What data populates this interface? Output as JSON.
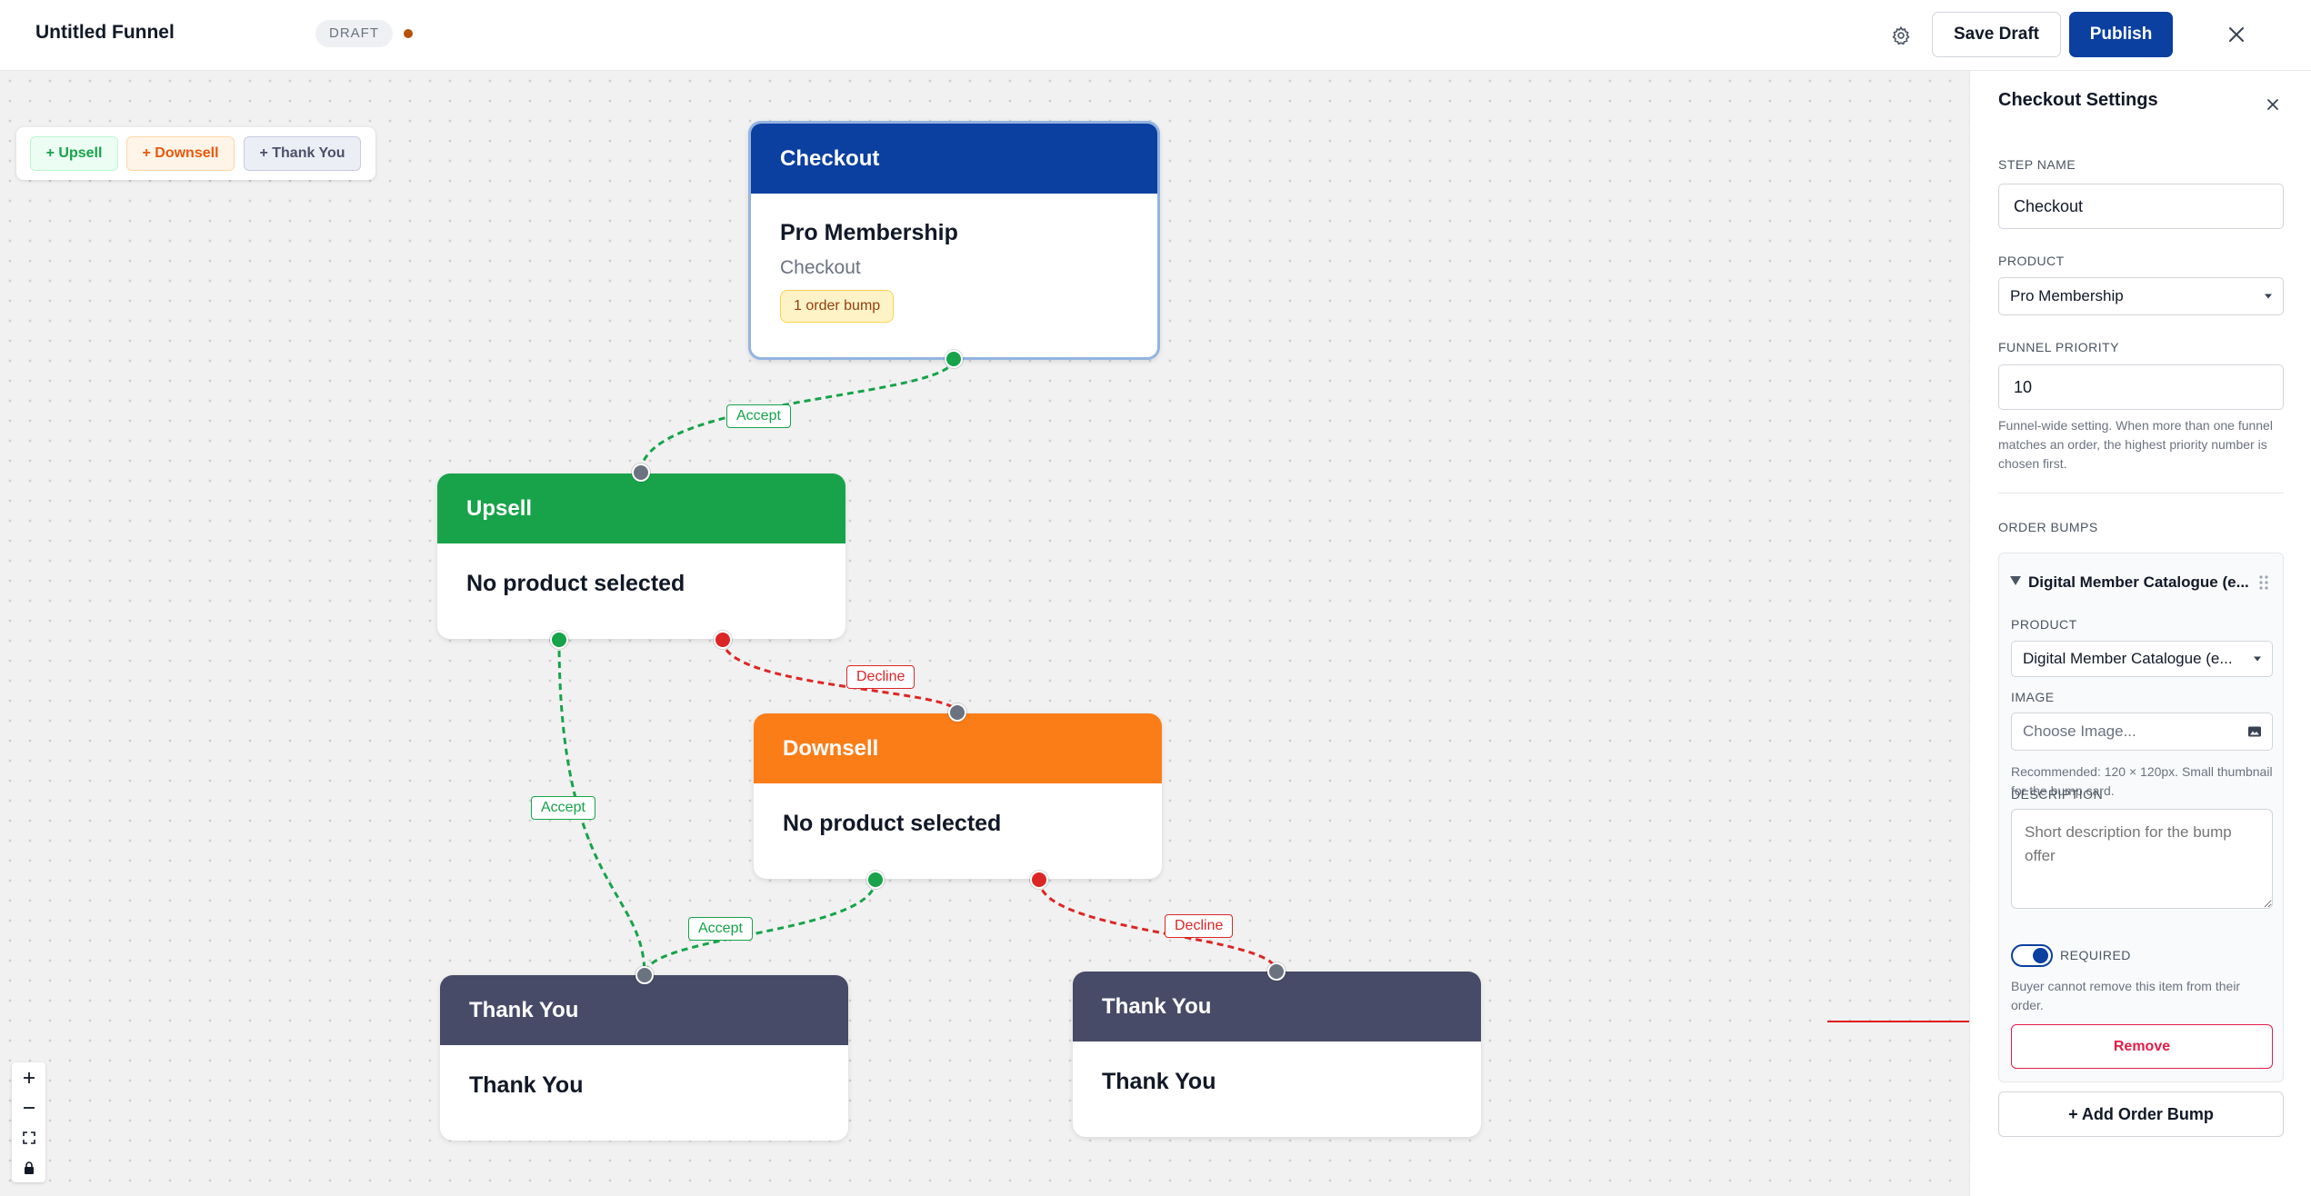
{
  "header": {
    "title": "Untitled Funnel",
    "status_badge": "DRAFT",
    "save_draft_label": "Save Draft",
    "publish_label": "Publish"
  },
  "toolbar": {
    "add_upsell": "+ Upsell",
    "add_downsell": "+ Downsell",
    "add_thank_you": "+ Thank You"
  },
  "nodes": {
    "checkout": {
      "header": "Checkout",
      "title": "Pro Membership",
      "subtitle": "Checkout",
      "badge": "1 order bump"
    },
    "upsell": {
      "header": "Upsell",
      "title": "No product selected"
    },
    "downsell": {
      "header": "Downsell",
      "title": "No product selected"
    },
    "thank_you_1": {
      "header": "Thank You",
      "title": "Thank You"
    },
    "thank_you_2": {
      "header": "Thank You",
      "title": "Thank You"
    }
  },
  "edges": {
    "checkout_accept": "Accept",
    "upsell_accept": "Accept",
    "upsell_decline": "Decline",
    "downsell_accept": "Accept",
    "downsell_decline": "Decline"
  },
  "panel": {
    "title": "Checkout Settings",
    "step_name_label": "STEP NAME",
    "step_name_value": "Checkout",
    "product_label": "PRODUCT",
    "product_value": "Pro Membership",
    "priority_label": "FUNNEL PRIORITY",
    "priority_value": "10",
    "priority_help": "Funnel-wide setting. When more than one funnel matches an order, the highest priority number is chosen first.",
    "order_bumps_label": "ORDER BUMPS",
    "bump": {
      "title": "Digital Member Catalogue (e...",
      "product_label": "PRODUCT",
      "product_value": "Digital Member Catalogue (e...",
      "image_label": "IMAGE",
      "image_placeholder": "Choose Image...",
      "image_help": "Recommended: 120 × 120px. Small thumbnail for the bump card.",
      "description_label": "DESCRIPTION",
      "description_placeholder": "Short description for the bump offer",
      "required_label": "REQUIRED",
      "required_on": true,
      "required_help": "Buyer cannot remove this item from their order.",
      "remove_label": "Remove"
    },
    "add_bump_label": "+ Add Order Bump"
  },
  "colors": {
    "primary": "#0b3fa0",
    "checkout": "#0b3fa0",
    "upsell": "#18a34a",
    "downsell": "#fb7d18",
    "thank_you": "#474b67",
    "accept": "#16a34a",
    "decline": "#dc2626",
    "annotation": "#e11d1d"
  },
  "icons": {
    "settings": "gear-icon",
    "close": "close-icon",
    "zoom_in": "plus-icon",
    "zoom_out": "minus-icon",
    "fit_view": "fit-view-icon",
    "lock": "lock-icon",
    "collapse": "triangle-down-icon",
    "drag": "drag-handle-icon",
    "image": "image-icon",
    "dropdown": "chevron-down-icon"
  }
}
